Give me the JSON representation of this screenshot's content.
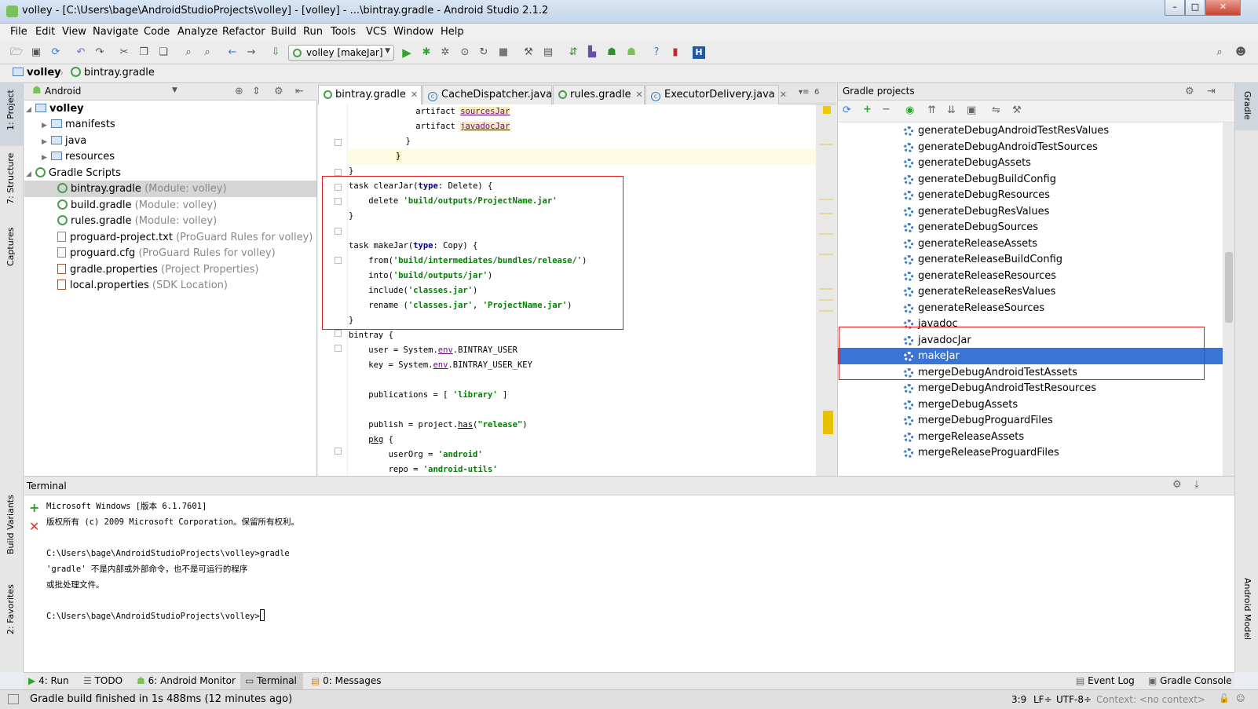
{
  "window": {
    "title": "volley - [C:\\Users\\bage\\AndroidStudioProjects\\volley] - [volley] - ...\\bintray.gradle - Android Studio 2.1.2"
  },
  "menu": [
    "File",
    "Edit",
    "View",
    "Navigate",
    "Code",
    "Analyze",
    "Refactor",
    "Build",
    "Run",
    "Tools",
    "VCS",
    "Window",
    "Help"
  ],
  "toolbar": {
    "run_config": "volley [makeJar]"
  },
  "breadcrumb": {
    "project": "volley",
    "file": "bintray.gradle"
  },
  "left_strip": {
    "project": "1: Project",
    "structure": "7: Structure",
    "captures": "Captures",
    "build_variants": "Build Variants",
    "favorites": "2: Favorites"
  },
  "right_strip": {
    "gradle": "Gradle",
    "android_model": "Android Model"
  },
  "project_panel": {
    "view": "Android",
    "tree": [
      {
        "label": "volley",
        "hint": ""
      },
      {
        "label": "manifests",
        "hint": ""
      },
      {
        "label": "java",
        "hint": ""
      },
      {
        "label": "resources",
        "hint": ""
      },
      {
        "label": "Gradle Scripts",
        "hint": ""
      },
      {
        "label": "bintray.gradle",
        "hint": "(Module: volley)"
      },
      {
        "label": "build.gradle",
        "hint": "(Module: volley)"
      },
      {
        "label": "rules.gradle",
        "hint": "(Module: volley)"
      },
      {
        "label": "proguard-project.txt",
        "hint": "(ProGuard Rules for volley)"
      },
      {
        "label": "proguard.cfg",
        "hint": "(ProGuard Rules for volley)"
      },
      {
        "label": "gradle.properties",
        "hint": "(Project Properties)"
      },
      {
        "label": "local.properties",
        "hint": "(SDK Location)"
      }
    ]
  },
  "editor": {
    "tabs": [
      "bintray.gradle",
      "CacheDispatcher.java",
      "rules.gradle",
      "ExecutorDelivery.java"
    ],
    "overflow": "6"
  },
  "gradle_panel": {
    "title": "Gradle projects",
    "tasks": [
      "generateDebugAndroidTestResValues",
      "generateDebugAndroidTestSources",
      "generateDebugAssets",
      "generateDebugBuildConfig",
      "generateDebugResources",
      "generateDebugResValues",
      "generateDebugSources",
      "generateReleaseAssets",
      "generateReleaseBuildConfig",
      "generateReleaseResources",
      "generateReleaseResValues",
      "generateReleaseSources",
      "javadoc",
      "javadocJar",
      "makeJar",
      "mergeDebugAndroidTestAssets",
      "mergeDebugAndroidTestResources",
      "mergeDebugAssets",
      "mergeDebugProguardFiles",
      "mergeReleaseAssets",
      "mergeReleaseProguardFiles"
    ],
    "selected": "makeJar"
  },
  "terminal": {
    "title": "Terminal",
    "lines": [
      "Microsoft Windows [版本 6.1.7601]",
      "版权所有 (c) 2009 Microsoft Corporation。保留所有权利。",
      "",
      "C:\\Users\\bage\\AndroidStudioProjects\\volley>gradle",
      "'gradle' 不是内部或外部命令，也不是可运行的程序",
      "或批处理文件。",
      "",
      "C:\\Users\\bage\\AndroidStudioProjects\\volley>"
    ]
  },
  "bottom_tabs": {
    "run": "4: Run",
    "todo": "TODO",
    "monitor": "6: Android Monitor",
    "terminal": "Terminal",
    "messages": "0: Messages",
    "event_log": "Event Log",
    "gradle_console": "Gradle Console"
  },
  "status": {
    "message": "Gradle build finished in 1s 488ms (12 minutes ago)",
    "position": "3:9",
    "line_sep": "LF÷",
    "encoding": "UTF-8÷",
    "context": "Context: <no context>"
  }
}
